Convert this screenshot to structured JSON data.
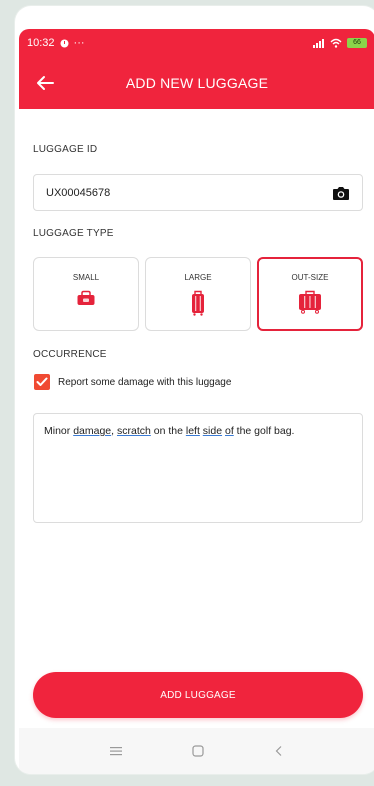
{
  "statusbar": {
    "time": "10:32",
    "battery": "66"
  },
  "appbar": {
    "title": "ADD NEW LUGGAGE"
  },
  "luggage_id": {
    "label": "LUGGAGE ID",
    "value": "UX00045678"
  },
  "luggage_type": {
    "label": "LUGGAGE TYPE",
    "options": [
      {
        "label": "SMALL",
        "icon": "small-bag-icon",
        "selected": false
      },
      {
        "label": "LARGE",
        "icon": "suitcase-icon",
        "selected": false
      },
      {
        "label": "OUT-SIZE",
        "icon": "outsize-luggage-icon",
        "selected": true
      }
    ]
  },
  "occurrence": {
    "label": "OCCURRENCE",
    "checkbox_label": "Report some damage with this luggage",
    "checked": true,
    "note_parts": [
      "Minor ",
      "damage",
      ", ",
      "scratch",
      " on the ",
      "left",
      " ",
      "side",
      " ",
      "of",
      " the golf bag."
    ]
  },
  "cta": {
    "label": "ADD LUGGAGE"
  },
  "colors": {
    "accent": "#f0243d",
    "checkbox": "#f04a33",
    "selected_border": "#e5233b"
  },
  "navbar": {
    "items": [
      "menu-icon",
      "home-icon",
      "back-icon"
    ]
  }
}
